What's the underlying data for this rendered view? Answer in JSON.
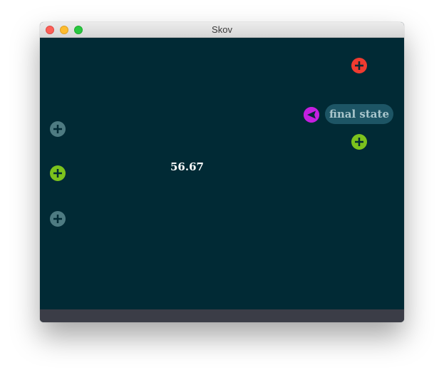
{
  "window": {
    "title": "Skov"
  },
  "canvas": {
    "value_label": "56.67",
    "state_label": "final state"
  },
  "colors": {
    "canvas_bg": "#012a35",
    "status_bar": "#3b3d47",
    "plus_gray": "#4e7b82",
    "plus_green": "#7cc21d",
    "plus_red": "#f03b30",
    "back_purple": "#c41fe0",
    "pill_bg": "#1d5565",
    "pill_text": "#a9c6cc"
  },
  "icons": {
    "add": "plus-icon",
    "back": "triangle-left-icon"
  }
}
